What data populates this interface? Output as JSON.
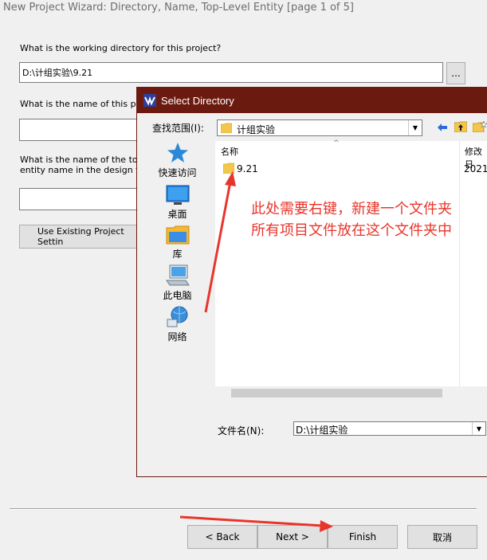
{
  "wizard": {
    "title": "New Project Wizard: Directory, Name, Top-Level Entity [page 1 of 5]",
    "q_directory": "What is the working directory for this project?",
    "directory_value": "D:\\计组实验\\9.21",
    "browse_label": "...",
    "q_name": "What is the name of this projec",
    "q_toplevel_line1": "What is the name of the top-lev",
    "q_toplevel_line2": "entity name in the design file.",
    "use_existing_label": "Use Existing Project Settin",
    "back_label": "< Back",
    "next_label": "Next >",
    "finish_label": "Finish",
    "cancel_label": "取消"
  },
  "dialog": {
    "title": "Select Directory",
    "lookin_label": "查找范围(I):",
    "lookin_value": "计组实验",
    "places": [
      {
        "label": "快速访问",
        "icon": "star-icon"
      },
      {
        "label": "桌面",
        "icon": "desktop-icon"
      },
      {
        "label": "库",
        "icon": "library-icon"
      },
      {
        "label": "此电脑",
        "icon": "computer-icon"
      },
      {
        "label": "网络",
        "icon": "network-icon"
      }
    ],
    "columns": {
      "name": "名称",
      "modified": "修改日"
    },
    "items": [
      {
        "name": "9.21",
        "modified": "2021"
      }
    ],
    "filename_label": "文件名(N):",
    "filename_value": "D:\\计组实验"
  },
  "annotation": {
    "line1": "此处需要右键，新建一个文件夹",
    "line2": "所有项目文件放在这个文件夹中",
    "color": "#e8352b"
  }
}
